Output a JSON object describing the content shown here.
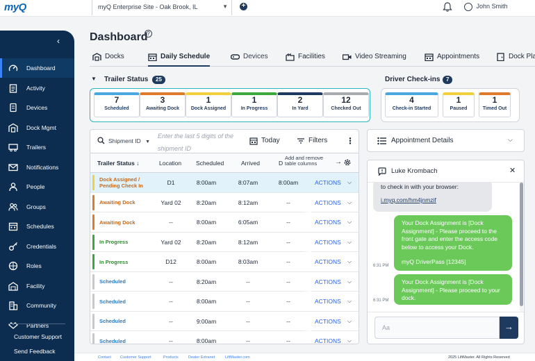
{
  "topbar": {
    "logo": "myQ",
    "site": "myQ Enterprise Site - Oak Brook, IL",
    "user": "John Smith"
  },
  "sidebar": {
    "items": [
      {
        "label": "Dashboard",
        "icon": "gauge-icon"
      },
      {
        "label": "Activity",
        "icon": "clipboard-icon"
      },
      {
        "label": "Devices",
        "icon": "device-icon"
      },
      {
        "label": "Dock Mgmt",
        "icon": "dock-icon"
      },
      {
        "label": "Trailers",
        "icon": "truck-icon"
      },
      {
        "label": "Notifications",
        "icon": "envelope-icon"
      },
      {
        "label": "People",
        "icon": "person-icon"
      },
      {
        "label": "Groups",
        "icon": "group-icon"
      },
      {
        "label": "Schedules",
        "icon": "calendar-icon"
      },
      {
        "label": "Credentials",
        "icon": "key-icon"
      },
      {
        "label": "Roles",
        "icon": "role-icon"
      },
      {
        "label": "Facility",
        "icon": "warehouse-icon"
      },
      {
        "label": "Community",
        "icon": "building-icon"
      },
      {
        "label": "Partners",
        "icon": "handshake-icon"
      }
    ],
    "support": "Customer Support",
    "feedback": "Send Feedback"
  },
  "page": {
    "title": "Dashboard",
    "help": "?"
  },
  "tabs": [
    {
      "label": "Docks"
    },
    {
      "label": "Daily Schedule"
    },
    {
      "label": "Devices"
    },
    {
      "label": "Facilities"
    },
    {
      "label": "Video Streaming"
    },
    {
      "label": "Appointments"
    },
    {
      "label": "Dock Pla"
    }
  ],
  "trailer_status": {
    "label": "Trailer Status",
    "count": "25",
    "cards": [
      {
        "num": "7",
        "label": "Scheduled",
        "color": "#4aa8e0"
      },
      {
        "num": "3",
        "label": "Awaiting Dock",
        "color": "#e07a2b"
      },
      {
        "num": "1",
        "label": "Dock Assigned",
        "color": "#f2d23c"
      },
      {
        "num": "1",
        "label": "In Progress",
        "color": "#3aa83a"
      },
      {
        "num": "2",
        "label": "In Yard",
        "color": "#1f3a5f"
      },
      {
        "num": "12",
        "label": "Checked Out",
        "color": "#a7acb1"
      }
    ]
  },
  "driver_checkins": {
    "label": "Driver Check-ins",
    "count": "7",
    "cards": [
      {
        "num": "4",
        "label": "Check-in Started",
        "color": "#4aa8e0"
      },
      {
        "num": "1",
        "label": "Paused",
        "color": "#f2d23c"
      },
      {
        "num": "1",
        "label": "Timed Out",
        "color": "#e07a2b"
      }
    ]
  },
  "schedule": {
    "filter_field": "Shipment ID",
    "search_placeholder": "Enter the last 5 digits of the shipment ID",
    "today": "Today",
    "filters": "Filters",
    "more": "⋮",
    "columns": [
      "Trailer Status ↓",
      "Location",
      "Scheduled",
      "Arrived",
      "D"
    ],
    "column_hint": "Add and remove table columns",
    "action_label": "ACTIONS",
    "rows": [
      {
        "status": "Dock Assigned / Pending Check In",
        "color": "#f2d23c",
        "text": "#c76a1a",
        "location": "D1",
        "scheduled": "8:00am",
        "arrived": "8:07am",
        "extra": "8:00am",
        "highlight": true
      },
      {
        "status": "Awaiting Dock",
        "color": "#e07a2b",
        "text": "#c76a1a",
        "location": "Yard 02",
        "scheduled": "8:20am",
        "arrived": "8:12am",
        "extra": "--",
        "highlight": false
      },
      {
        "status": "Awaiting Dock",
        "color": "#e07a2b",
        "text": "#c76a1a",
        "location": "--",
        "scheduled": "8:00am",
        "arrived": "6:05am",
        "extra": "--",
        "highlight": false
      },
      {
        "status": "In Progress",
        "color": "#3aa83a",
        "text": "#2e8b2e",
        "location": "Yard 02",
        "scheduled": "8:20am",
        "arrived": "8:12am",
        "extra": "--",
        "highlight": false
      },
      {
        "status": "In Progress",
        "color": "#3aa83a",
        "text": "#2e8b2e",
        "location": "D12",
        "scheduled": "8:00am",
        "arrived": "8:03am",
        "extra": "--",
        "highlight": false
      },
      {
        "status": "Scheduled",
        "color": "#c5c9ce",
        "text": "#2b7bc4",
        "location": "--",
        "scheduled": "8:20am",
        "arrived": "--",
        "extra": "--",
        "highlight": false
      },
      {
        "status": "Scheduled",
        "color": "#c5c9ce",
        "text": "#2b7bc4",
        "location": "--",
        "scheduled": "8:00am",
        "arrived": "--",
        "extra": "--",
        "highlight": false
      },
      {
        "status": "Scheduled",
        "color": "#c5c9ce",
        "text": "#2b7bc4",
        "location": "--",
        "scheduled": "9:00am",
        "arrived": "--",
        "extra": "--",
        "highlight": false
      },
      {
        "status": "Scheduled",
        "color": "#c5c9ce",
        "text": "#2b7bc4",
        "location": "--",
        "scheduled": "8:00am",
        "arrived": "--",
        "extra": "--",
        "highlight": false
      }
    ]
  },
  "appointment": {
    "label": "Appointment Details"
  },
  "chat": {
    "name": "Luke Krombach",
    "incoming_text": "to check in with your browser:",
    "incoming_link": "i.myq.com/hm4jnmzif",
    "outgoing": [
      {
        "text": "Your Dock Assignment is [Dock Assignment] - Please proceed to the front gate and enter the access code below to access your Dock.",
        "code": "myQ DriverPass [12345]",
        "time": "6:31 PM"
      },
      {
        "text": "Your Dock Assignment is [Dock Assignment] - Please proceed to your dock.",
        "code": "",
        "time": "6:31 PM"
      }
    ],
    "input_placeholder": "Aa"
  },
  "footer": {
    "links": [
      "Contact",
      "Customer Support",
      "Products",
      "Dealer Extranet",
      "LiftMaster.com"
    ],
    "copyright": "2025 LiftMaster. All Rights Reserved"
  }
}
